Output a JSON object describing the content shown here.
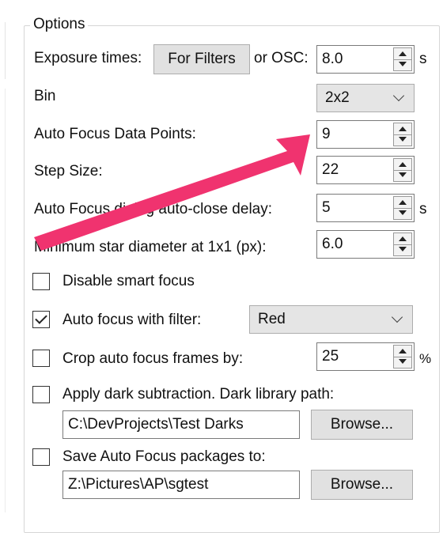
{
  "group": {
    "title": "Options"
  },
  "rows": {
    "exposure": {
      "label": "Exposure times:",
      "button": "For Filters",
      "or_label": "or OSC:",
      "value": "8.0",
      "unit": "s"
    },
    "bin": {
      "label": "Bin",
      "value": "2x2"
    },
    "af_points": {
      "label": "Auto Focus Data Points:",
      "value": "9"
    },
    "step_size": {
      "label": "Step Size:",
      "value": "22"
    },
    "autoclose": {
      "label": "Auto Focus dialog auto-close delay:",
      "value": "5",
      "unit": "s"
    },
    "min_star": {
      "label": "Minimum star diameter at 1x1 (px):",
      "value": "6.0"
    }
  },
  "checks": {
    "smart_focus": {
      "label": "Disable smart focus",
      "checked": false
    },
    "with_filter": {
      "label": "Auto focus with filter:",
      "checked": true,
      "value": "Red"
    },
    "crop": {
      "label": "Crop auto focus frames by:",
      "checked": false,
      "value": "25",
      "unit": "%"
    },
    "dark": {
      "label": "Apply dark subtraction.  Dark library path:",
      "checked": false,
      "path": "C:\\DevProjects\\Test Darks",
      "browse": "Browse..."
    },
    "save_pkg": {
      "label": "Save Auto Focus packages to:",
      "checked": false,
      "path": "Z:\\Pictures\\AP\\sgtest",
      "browse": "Browse..."
    }
  },
  "annotation": {
    "color": "#f0336f"
  }
}
